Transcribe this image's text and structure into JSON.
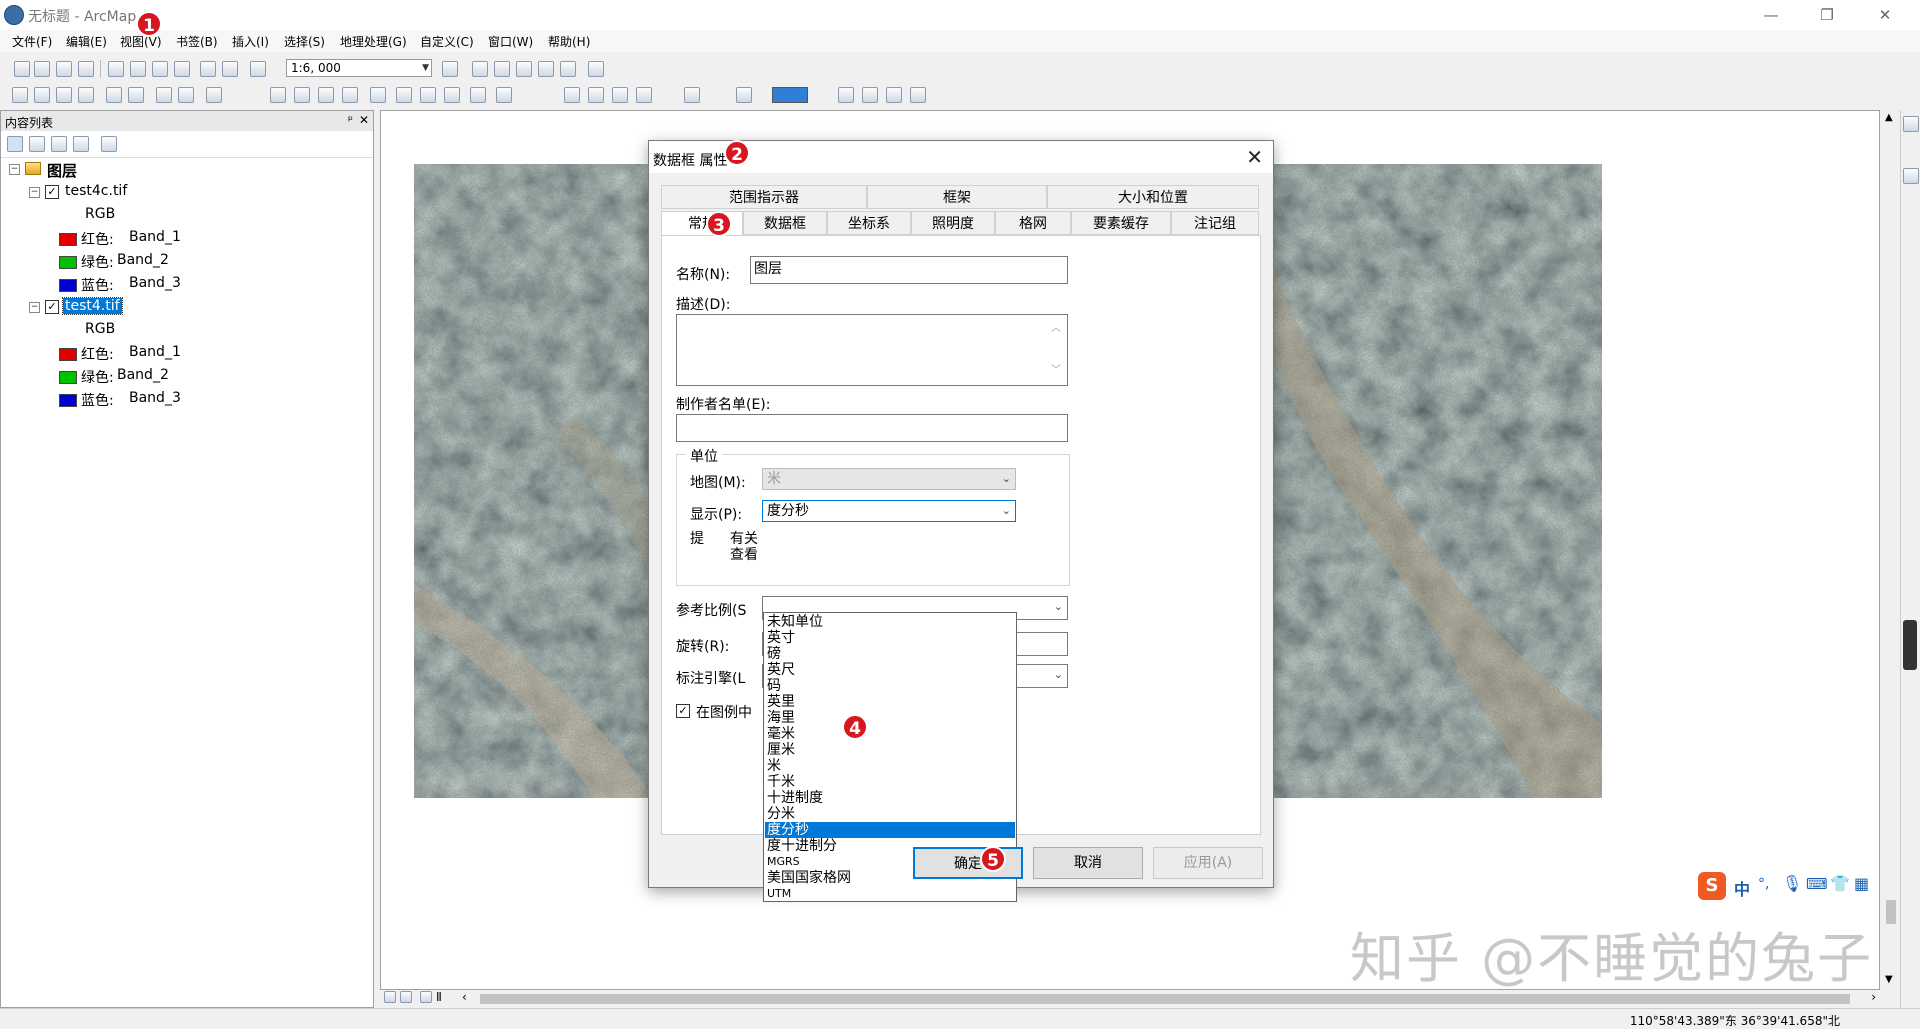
{
  "window": {
    "title": "无标题 - ArcMap"
  },
  "menu": [
    "文件(F)",
    "编辑(E)",
    "视图(V)",
    "书签(B)",
    "插入(I)",
    "选择(S)",
    "地理处理(G)",
    "自定义(C)",
    "窗口(W)",
    "帮助(H)"
  ],
  "toolbar": {
    "scale": "1:6, 000"
  },
  "toc": {
    "header": "内容列表",
    "pin": "ᵖ",
    "close": "✕",
    "root": "图层",
    "layers": [
      {
        "name": "test4c.tif",
        "checked": true,
        "selected": false,
        "render": "RGB",
        "bands": [
          {
            "label": "红色:",
            "band": "Band_1",
            "color": "#e00000"
          },
          {
            "label": "绿色:",
            "band": "Band_2",
            "color": "#00c000"
          },
          {
            "label": "蓝色:",
            "band": "Band_3",
            "color": "#0000d0"
          }
        ]
      },
      {
        "name": "test4.tif",
        "checked": true,
        "selected": true,
        "render": "RGB",
        "bands": [
          {
            "label": "红色:",
            "band": "Band_1",
            "color": "#e00000"
          },
          {
            "label": "绿色:",
            "band": "Band_2",
            "color": "#00c000"
          },
          {
            "label": "蓝色:",
            "band": "Band_3",
            "color": "#0000d0"
          }
        ]
      }
    ]
  },
  "dialog": {
    "title": "数据框 属性",
    "close": "✕",
    "tabs_row1": [
      "范围指示器",
      "框架",
      "大小和位置"
    ],
    "tabs_row2": [
      "常规",
      "数据框",
      "坐标系",
      "照明度",
      "格网",
      "要素缓存",
      "注记组"
    ],
    "active_tab": "常规",
    "name_label": "名称(N):",
    "name_value": "图层",
    "desc_label": "描述(D):",
    "credits_label": "制作者名单(E):",
    "units_group": "单位",
    "map_label": "地图(M):",
    "map_value": "米",
    "display_label": "显示(P):",
    "display_value": "度分秒",
    "tip_label": "提",
    "tip_text1": "有关",
    "tip_text2": "查看",
    "refscale_label": "参考比例(S",
    "rotation_label": "旋转(R):",
    "label_engine_label": "标注引擎(L",
    "legend_check_label": "在图例中",
    "dropdown_options": [
      "未知单位",
      "英寸",
      "磅",
      "英尺",
      "码",
      "英里",
      "海里",
      "毫米",
      "厘米",
      "米",
      "千米",
      "十进制度",
      "分米",
      "度分秒",
      "度十进制分",
      "MGRS",
      "美国国家格网",
      "UTM"
    ],
    "selected_option": "度分秒",
    "ok": "确定",
    "cancel": "取消",
    "apply": "应用(A)"
  },
  "markers": [
    "1",
    "2",
    "3",
    "4",
    "5"
  ],
  "status": {
    "coords": "110°58'43.389\"东  36°39'41.658\"北"
  },
  "watermark": "知乎 @不睡觉的兔子",
  "ime": {
    "logo": "S",
    "lang": "中"
  },
  "colors": {
    "selection": "#0078d7",
    "marker": "#d7171f"
  }
}
